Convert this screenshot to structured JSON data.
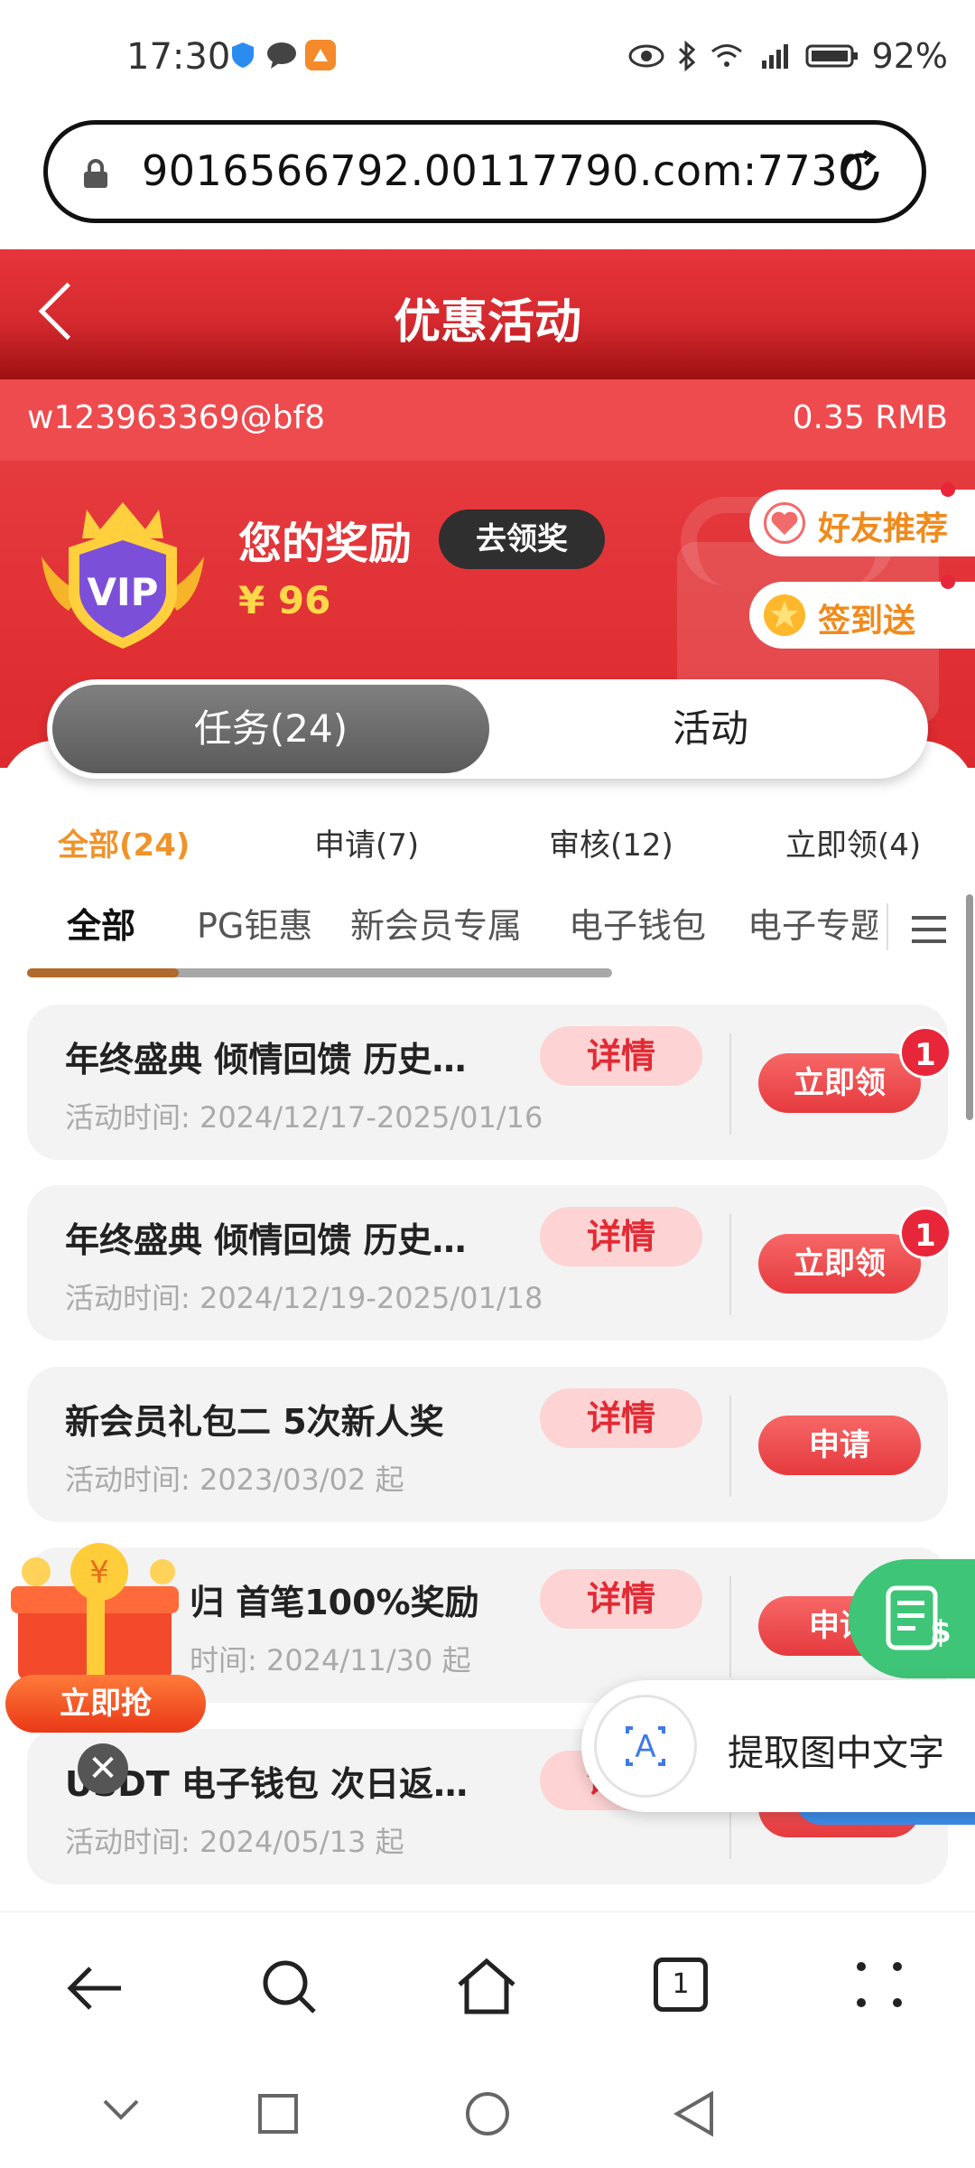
{
  "status_bar": {
    "time": "17:30",
    "battery": "92%",
    "icons": [
      "shield-icon",
      "chat-icon",
      "app-icon",
      "eye-icon",
      "bluetooth-icon",
      "wifi-icon",
      "signal-icon",
      "battery-icon"
    ]
  },
  "address_bar": {
    "url": "9016566792.00117790.com:7730"
  },
  "header": {
    "title": "优惠活动"
  },
  "account": {
    "username": "w123963369@bf8",
    "balance": "0.35 RMB"
  },
  "reward": {
    "title": "您的奖励",
    "claim_button": "去领奖",
    "amount": "¥ 96",
    "vip_label": "VIP"
  },
  "side_pills": {
    "friend": "好友推荐",
    "checkin": "签到送"
  },
  "main_toggle": {
    "tasks": "任务(24)",
    "activities": "活动"
  },
  "sub_tabs": [
    "全部(24)",
    "申请(7)",
    "审核(12)",
    "立即领(4)"
  ],
  "categories": [
    "全部",
    "PG钜惠",
    "新会员专属",
    "电子钱包",
    "电子专题"
  ],
  "category_scroll_progress": 0.26,
  "rows": [
    {
      "name": "年终盛典 倾情回馈 历史…",
      "time": "活动时间:  2024/12/17-2025/01/16",
      "detail": "详情",
      "action": "立即领",
      "badge": "1"
    },
    {
      "name": "年终盛典 倾情回馈 历史…",
      "time": "活动时间:  2024/12/19-2025/01/18",
      "detail": "详情",
      "action": "立即领",
      "badge": "1"
    },
    {
      "name": "新会员礼包二 5次新人奖",
      "time": "活动时间:  2023/03/02 起",
      "detail": "详情",
      "action": "申请",
      "badge": ""
    },
    {
      "name": "归 首笔100%奖励",
      "time": "时间:  2024/11/30 起",
      "detail": "详情",
      "action": "申请",
      "badge": ""
    },
    {
      "name": "USDT 电子钱包 次日返…",
      "time": "活动时间:  2024/05/13 起",
      "detail": "详情",
      "action": "申请",
      "badge": ""
    }
  ],
  "promo": {
    "button": "立即抢",
    "close": "✕"
  },
  "ocr": {
    "label": "提取图中文字"
  },
  "browser_bar": {
    "tabs_count": "1"
  }
}
